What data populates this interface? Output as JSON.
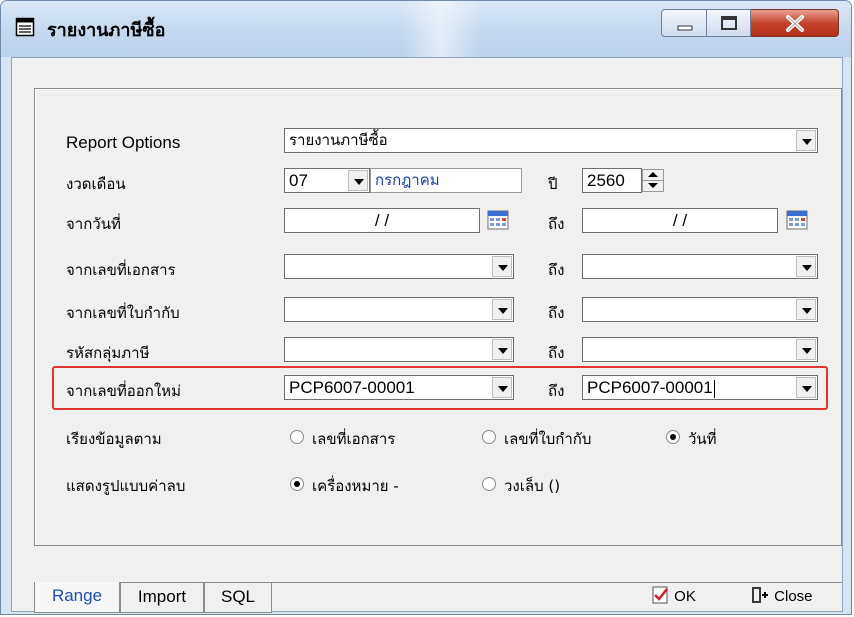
{
  "window": {
    "title": "รายงานภาษีซื้อ"
  },
  "form": {
    "report_options": {
      "label": "Report Options",
      "value": "รายงานภาษีซื้อ"
    },
    "period": {
      "label": "งวดเดือน",
      "month": "07",
      "month_name": "กรกฎาคม",
      "year_label": "ปี",
      "year": "2560"
    },
    "from_date": {
      "label": "จากวันที่",
      "from": "/ /",
      "to_label": "ถึง",
      "to": "/ /"
    },
    "from_doc_no": {
      "label": "จากเลขที่เอกสาร",
      "to_label": "ถึง"
    },
    "from_invoice_no": {
      "label": "จากเลขที่ใบกำกับ",
      "to_label": "ถึง"
    },
    "tax_group": {
      "label": "รหัสกลุ่มภาษี",
      "to_label": "ถึง"
    },
    "from_new_no": {
      "label": "จากเลขที่ออกใหม่",
      "from": "PCP6007-00001",
      "to_label": "ถึง",
      "to": "PCP6007-00001"
    },
    "sort_by": {
      "label": "เรียงข้อมูลตาม",
      "options": [
        "เลขที่เอกสาร",
        "เลขที่ใบกำกับ",
        "วันที่"
      ],
      "selected": "วันที่"
    },
    "negative_format": {
      "label": "แสดงรูปแบบค่าลบ",
      "options": [
        "เครื่องหมาย -",
        "วงเล็บ ()"
      ],
      "selected": "เครื่องหมาย -"
    }
  },
  "tabs": [
    "Range",
    "Import",
    "SQL"
  ],
  "active_tab": "Range",
  "buttons": {
    "ok": "OK",
    "close": "Close"
  },
  "colors": {
    "highlight": "#e53232",
    "month_name": "#1a3fb5",
    "active_tab": "#1a4fb5"
  }
}
